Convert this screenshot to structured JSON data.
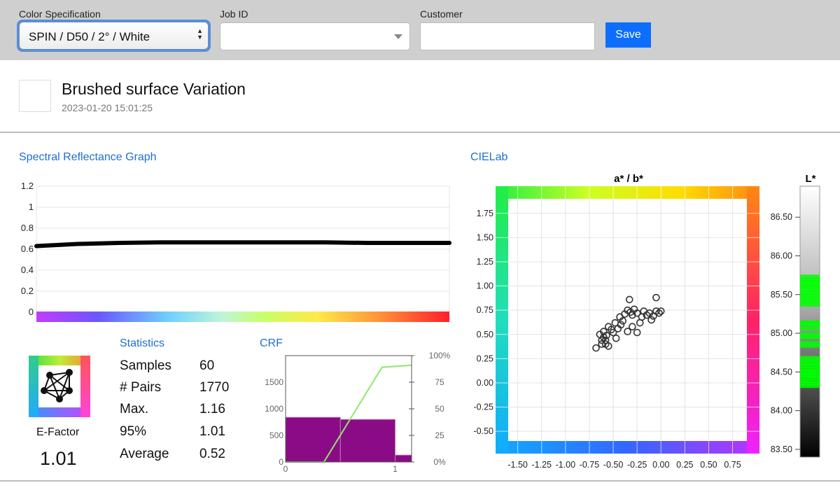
{
  "toolbar": {
    "color_spec_label": "Color Specification",
    "color_spec_value": "SPIN / D50 / 2° / White",
    "job_id_label": "Job ID",
    "job_id_value": "",
    "customer_label": "Customer",
    "customer_value": "",
    "save_label": "Save",
    "accent_color": "#0d6efd"
  },
  "header": {
    "title": "Brushed surface Variation",
    "timestamp": "2023-01-20 15:01:25"
  },
  "sections": {
    "spectral": "Spectral Reflectance Graph",
    "cielab": "CIELab",
    "statistics": "Statistics",
    "crf": "CRF"
  },
  "efactor": {
    "label": "E-Factor",
    "value": "1.01",
    "icon": "network-graph-icon"
  },
  "statistics": [
    {
      "label": "Samples",
      "value": "60"
    },
    {
      "label": "# Pairs",
      "value": "1770"
    },
    {
      "label": "Max.",
      "value": "1.16"
    },
    {
      "label": "95%",
      "value": "1.01"
    },
    {
      "label": "Average",
      "value": "0.52"
    }
  ],
  "chart_data": [
    {
      "id": "spectral",
      "type": "line",
      "title": "",
      "xlabel": "",
      "ylabel": "",
      "ylim": [
        0,
        1.2
      ],
      "y_ticks": [
        "1.2",
        "1",
        "0.8",
        "0.6",
        "0.4",
        "0.2",
        "0"
      ],
      "grid": true,
      "x": [
        0,
        0.1,
        0.2,
        0.3,
        0.4,
        0.5,
        0.6,
        0.7,
        0.8,
        0.9,
        1.0
      ],
      "series": [
        {
          "values": [
            0.63,
            0.65,
            0.66,
            0.665,
            0.665,
            0.665,
            0.665,
            0.665,
            0.66,
            0.66,
            0.66
          ],
          "color": "#000000"
        }
      ]
    },
    {
      "id": "crf",
      "type": "bar",
      "title": "",
      "left_ticks": [
        "1500",
        "1000",
        "500",
        "0"
      ],
      "right_ticks": [
        "100%",
        "75",
        "50",
        "25",
        "0%"
      ],
      "x_ticks": [
        "0",
        "1"
      ],
      "ylim_left": [
        0,
        2000
      ],
      "ylim_right": [
        0,
        100
      ],
      "bars": [
        {
          "x0": 0,
          "x1": 0.5,
          "value": 840
        },
        {
          "x0": 0.5,
          "x1": 1.0,
          "value": 800
        },
        {
          "x0": 1.0,
          "x1": 1.15,
          "value": 130
        }
      ],
      "cumulative_line": {
        "x": [
          0,
          0.35,
          0.88,
          1.15
        ],
        "y": [
          0,
          0,
          89,
          91
        ],
        "color": "#8fe86a"
      },
      "bar_color": "#8b0b86"
    },
    {
      "id": "cielab",
      "type": "scatter",
      "title": "a* / b*",
      "x_ticks": [
        "-1.50",
        "-1.25",
        "-1.00",
        "-0.75",
        "-0.50",
        "-0.25",
        "0.00",
        "0.25",
        "0.50",
        "0.75"
      ],
      "y_ticks": [
        "1.75",
        "1.50",
        "1.25",
        "1.00",
        "0.75",
        "0.50",
        "0.25",
        "0.00",
        "-0.25",
        "-0.50"
      ],
      "xlim": [
        -1.6,
        0.9
      ],
      "ylim": [
        -0.6,
        1.9
      ],
      "grid": true,
      "points": [
        [
          -0.68,
          0.36
        ],
        [
          -0.62,
          0.4
        ],
        [
          -0.58,
          0.44
        ],
        [
          -0.55,
          0.38
        ],
        [
          -0.6,
          0.47
        ],
        [
          -0.64,
          0.5
        ],
        [
          -0.6,
          0.53
        ],
        [
          -0.57,
          0.49
        ],
        [
          -0.52,
          0.55
        ],
        [
          -0.55,
          0.58
        ],
        [
          -0.5,
          0.52
        ],
        [
          -0.47,
          0.46
        ],
        [
          -0.45,
          0.56
        ],
        [
          -0.42,
          0.6
        ],
        [
          -0.4,
          0.64
        ],
        [
          -0.43,
          0.68
        ],
        [
          -0.38,
          0.71
        ],
        [
          -0.35,
          0.75
        ],
        [
          -0.32,
          0.73
        ],
        [
          -0.3,
          0.7
        ],
        [
          -0.33,
          0.86
        ],
        [
          -0.28,
          0.76
        ],
        [
          -0.25,
          0.72
        ],
        [
          -0.22,
          0.62
        ],
        [
          -0.2,
          0.68
        ],
        [
          -0.18,
          0.74
        ],
        [
          -0.15,
          0.7
        ],
        [
          -0.12,
          0.72
        ],
        [
          -0.1,
          0.65
        ],
        [
          -0.08,
          0.69
        ],
        [
          -0.05,
          0.74
        ],
        [
          -0.02,
          0.72
        ],
        [
          0.0,
          0.74
        ],
        [
          -0.05,
          0.88
        ],
        [
          -0.3,
          0.58
        ],
        [
          -0.35,
          0.53
        ],
        [
          -0.62,
          0.44
        ],
        [
          -0.48,
          0.62
        ],
        [
          -0.25,
          0.52
        ],
        [
          -0.58,
          0.4
        ]
      ]
    },
    {
      "id": "lstar",
      "type": "heatmap",
      "title": "L*",
      "y_ticks": [
        "86.50",
        "86.00",
        "85.50",
        "85.00",
        "84.50",
        "84.00",
        "83.50"
      ],
      "ylim": [
        83.4,
        86.9
      ],
      "highlight_color": "#00ff00",
      "samples": [
        85.73,
        85.69,
        85.66,
        85.62,
        85.6,
        85.56,
        85.52,
        85.48,
        85.45,
        85.41,
        85.37,
        85.14,
        85.12,
        85.06,
        84.98,
        84.95,
        84.87,
        84.84,
        84.68,
        84.65,
        84.61,
        84.58,
        84.54,
        84.51,
        84.48,
        84.45,
        84.42,
        84.38,
        84.35,
        84.32
      ]
    }
  ]
}
